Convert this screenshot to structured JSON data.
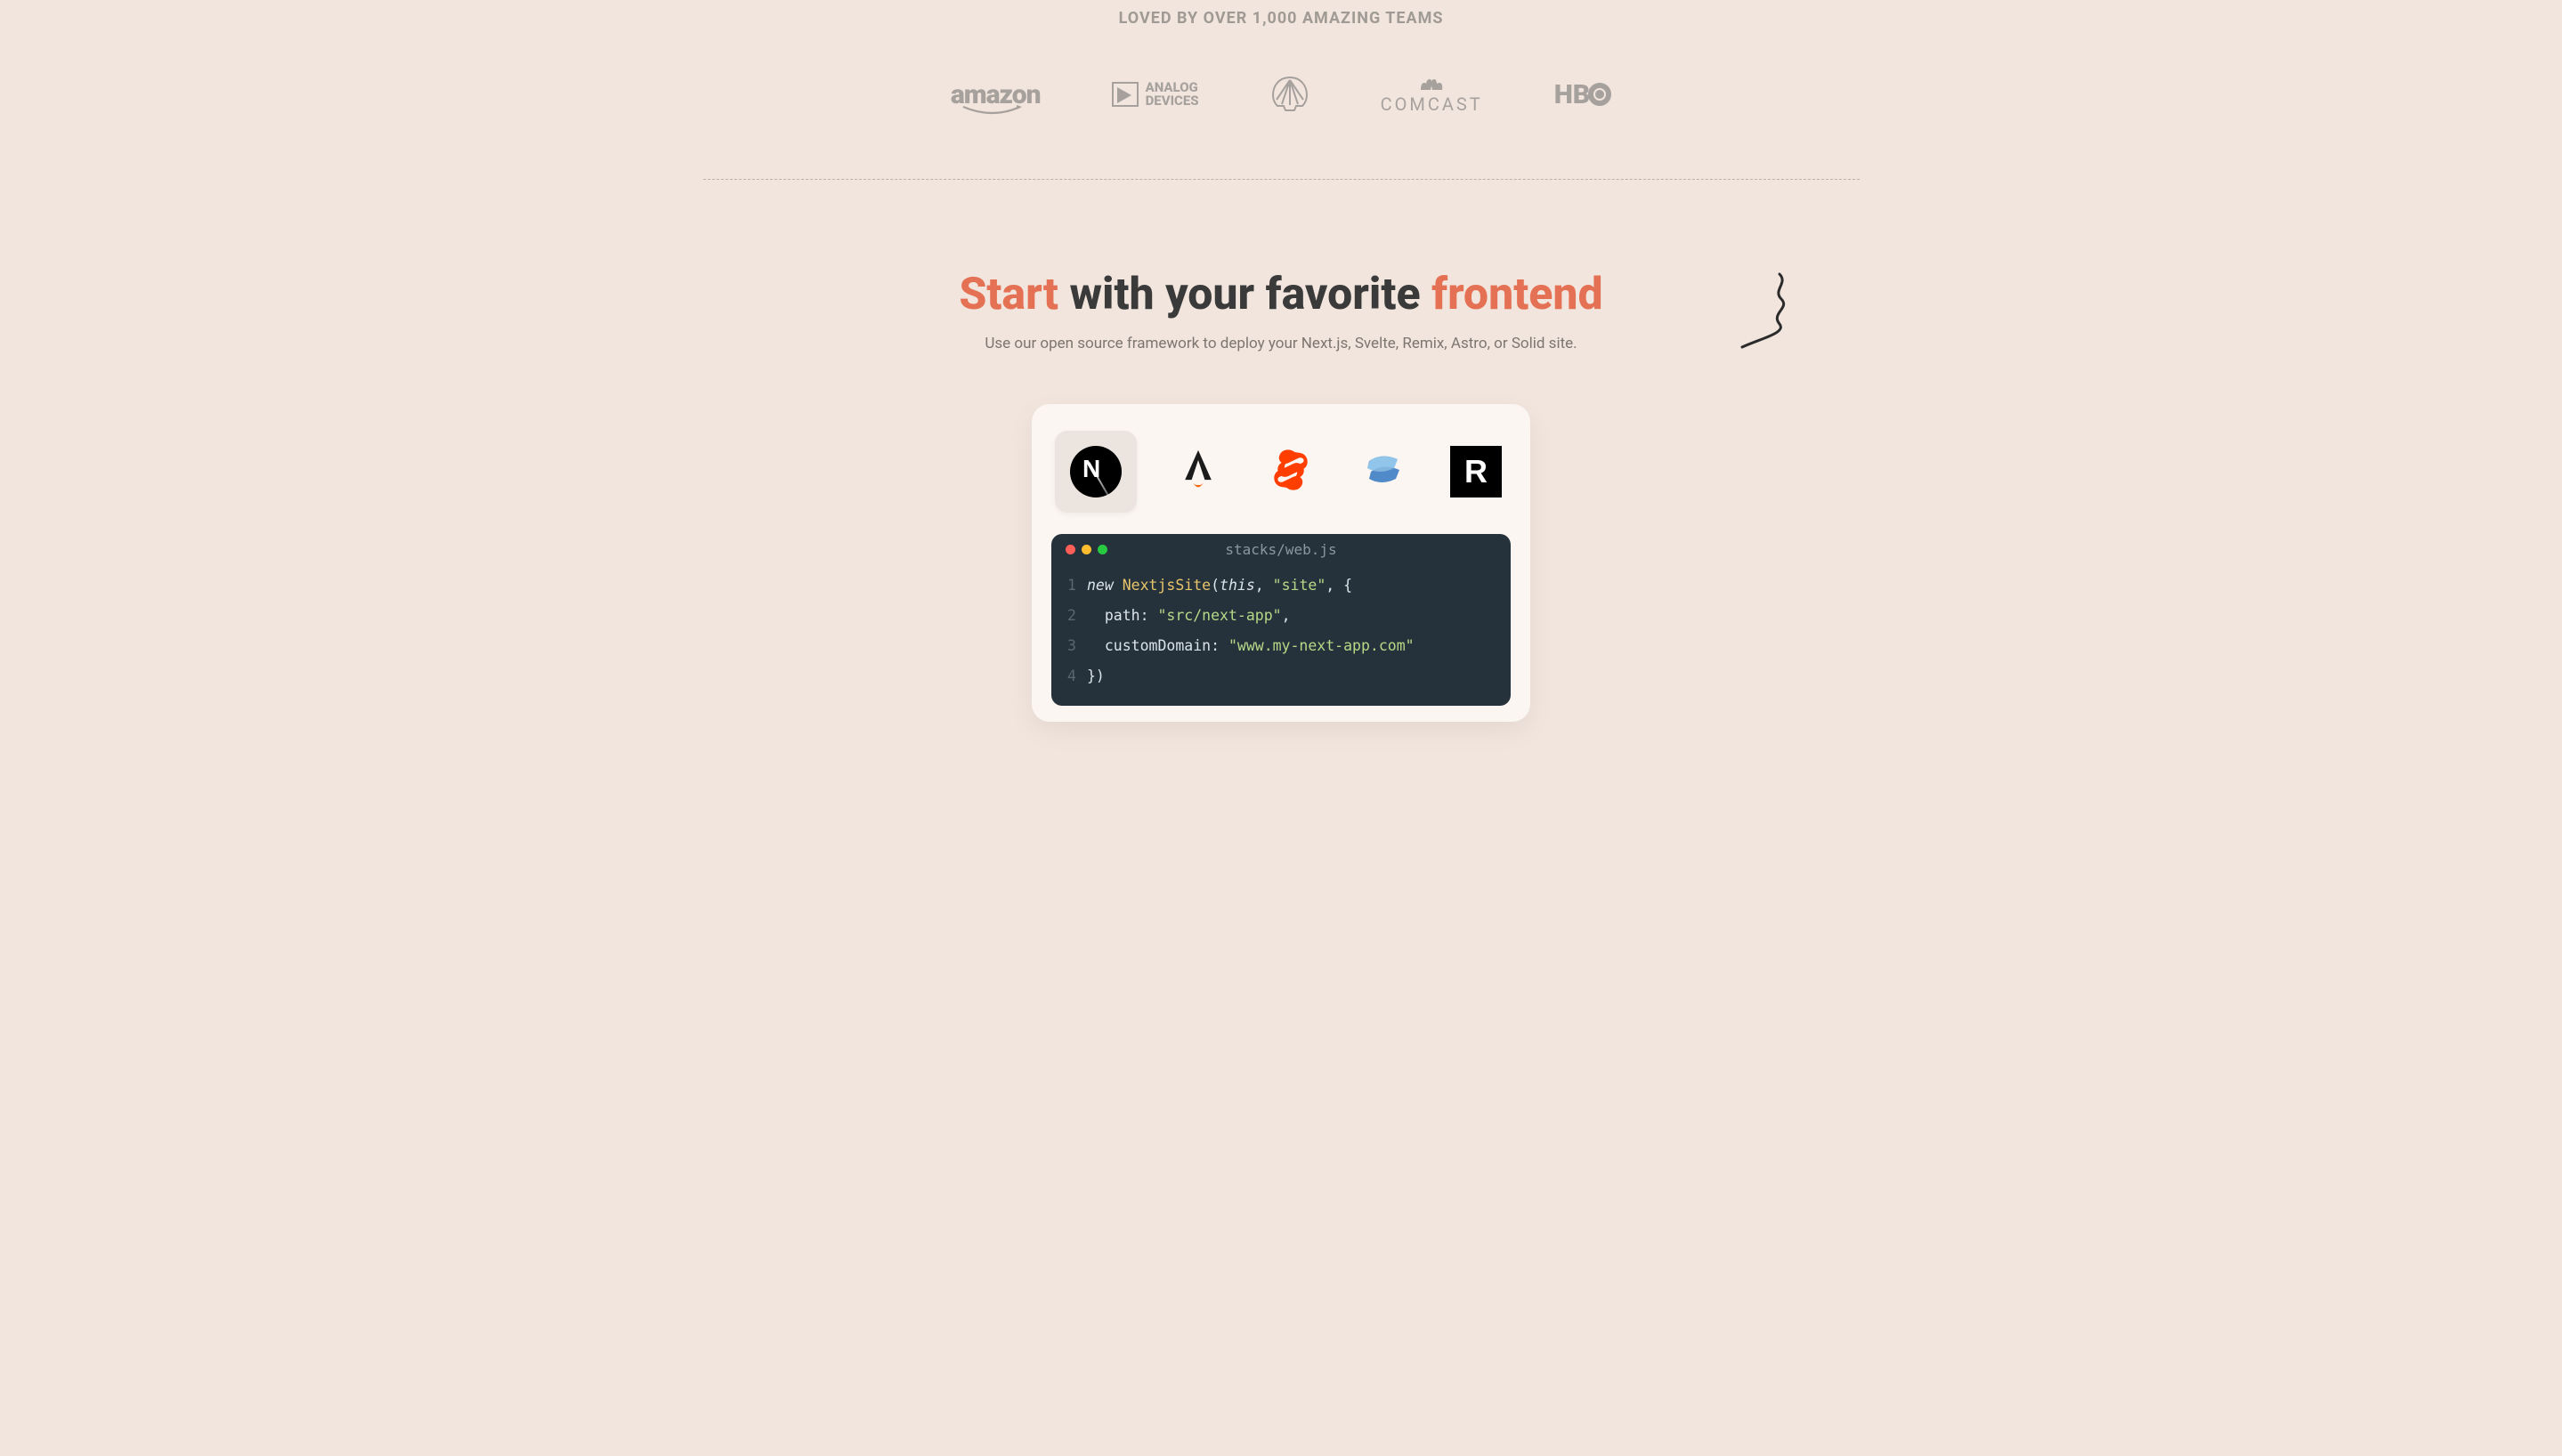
{
  "loved_heading": "LOVED BY OVER 1,000 AMAZING TEAMS",
  "team_logos": [
    {
      "name": "amazon",
      "label": "amazon"
    },
    {
      "name": "analog-devices",
      "label_top": "ANALOG",
      "label_bottom": "DEVICES"
    },
    {
      "name": "shell"
    },
    {
      "name": "comcast",
      "label": "COMCAST"
    },
    {
      "name": "hbo",
      "label": "HBO"
    }
  ],
  "section": {
    "heading_accent1": "Start",
    "heading_mid": " with your favorite ",
    "heading_accent2": "frontend",
    "subheading": "Use our open source framework to deploy your Next.js, Svelte, Remix, Astro, or Solid site."
  },
  "frameworks": [
    {
      "name": "nextjs",
      "selected": true
    },
    {
      "name": "astro",
      "selected": false
    },
    {
      "name": "svelte",
      "selected": false
    },
    {
      "name": "solid",
      "selected": false
    },
    {
      "name": "remix",
      "selected": false
    }
  ],
  "terminal": {
    "filename": "stacks/web.js",
    "lines": [
      {
        "n": "1",
        "tokens": [
          {
            "t": "new ",
            "c": "kw"
          },
          {
            "t": "NextjsSite",
            "c": "cls"
          },
          {
            "t": "(",
            "c": "punc"
          },
          {
            "t": "this",
            "c": "this"
          },
          {
            "t": ", ",
            "c": "punc"
          },
          {
            "t": "\"site\"",
            "c": "str"
          },
          {
            "t": ", {",
            "c": "punc"
          }
        ]
      },
      {
        "n": "2",
        "tokens": [
          {
            "t": "  path: ",
            "c": "prop"
          },
          {
            "t": "\"src/next-app\"",
            "c": "str"
          },
          {
            "t": ",",
            "c": "punc"
          }
        ]
      },
      {
        "n": "3",
        "tokens": [
          {
            "t": "  customDomain: ",
            "c": "prop"
          },
          {
            "t": "\"www.my-next-app.com\"",
            "c": "str"
          }
        ]
      },
      {
        "n": "4",
        "tokens": [
          {
            "t": "})",
            "c": "punc"
          }
        ]
      }
    ]
  }
}
